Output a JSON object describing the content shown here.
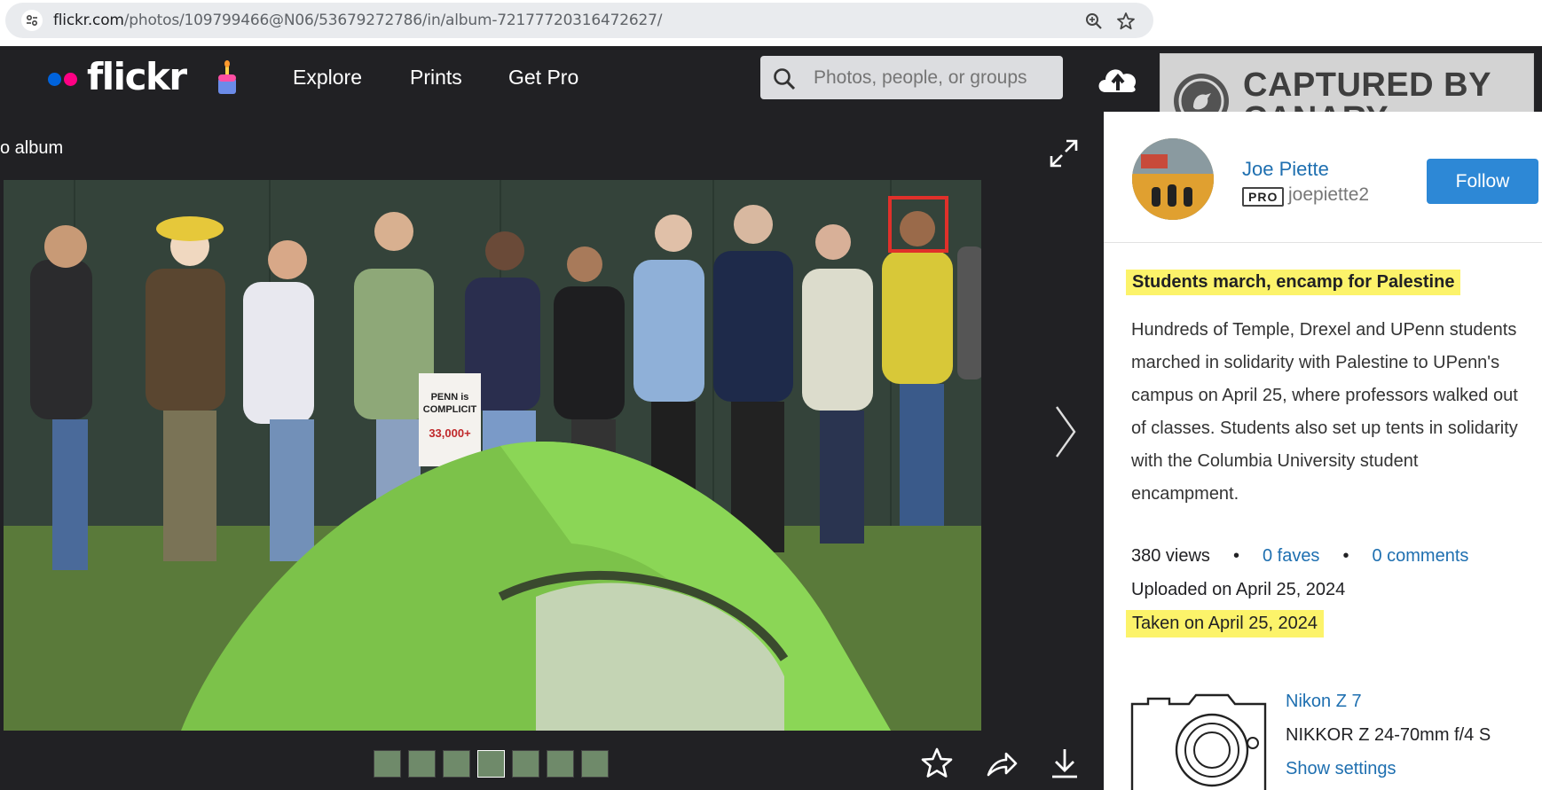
{
  "browser": {
    "url_host": "flickr.com",
    "url_path": "/photos/109799466@N06/53679272786/in/album-72177720316472627/"
  },
  "nav": {
    "logo": "flickr",
    "links": [
      "Explore",
      "Prints",
      "Get Pro"
    ],
    "search_placeholder": "Photos, people, or groups",
    "colors": {
      "blue_dot": "#0063dc",
      "pink_dot": "#ff0084",
      "nav_bg": "#212124"
    }
  },
  "watermark": {
    "line1": "CAPTURED BY",
    "line2": "CANARY MISSION"
  },
  "photo": {
    "back_label": "o album",
    "thumbnail_count": 7
  },
  "sidebar": {
    "author_name": "Joe Piette",
    "pro_badge": "PRO",
    "username": "joepiette2",
    "follow_label": "Follow",
    "title": "Students march, encamp for Palestine",
    "description": "Hundreds of Temple, Drexel and UPenn students marched in solidarity with Palestine to UPenn's campus on April 25, where professors walked out of classes. Students also set up tents in solidarity with the Columbia University student encampment.",
    "views": "380 views",
    "faves": "0 faves",
    "comments": "0 comments",
    "uploaded": "Uploaded on April 25, 2024",
    "taken": "Taken on April 25, 2024",
    "camera": "Nikon Z 7",
    "lens": "NIKKOR Z 24-70mm f/4 S",
    "show_settings": "Show settings",
    "highlight_color": "#fcf36a",
    "link_color": "#1e6fb0"
  }
}
